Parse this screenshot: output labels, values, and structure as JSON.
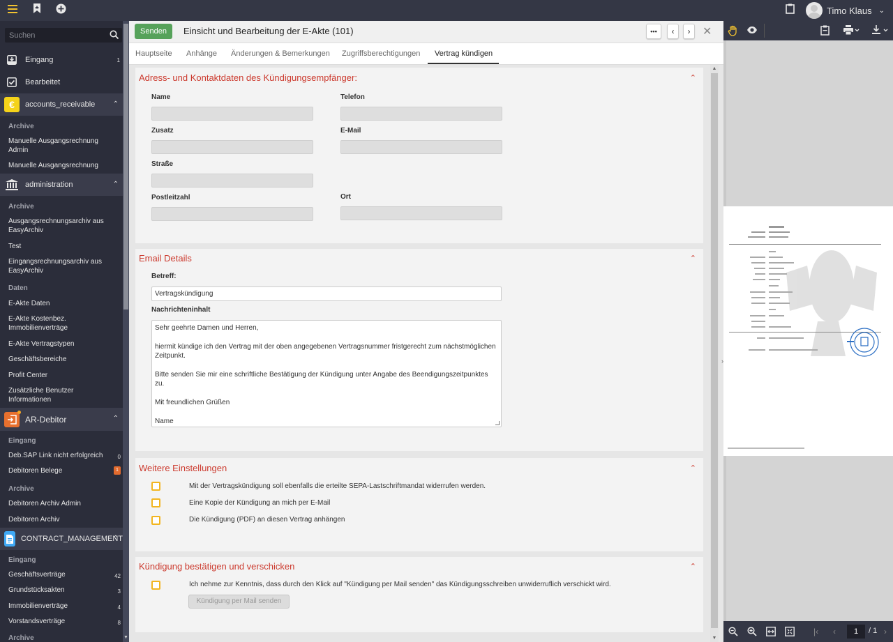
{
  "topbar": {
    "menu_icon": "hamburger-icon",
    "bookmark_icon": "bookmark-icon",
    "add_icon": "plus-circle-icon",
    "clipboard_icon": "clipboard-icon",
    "user_name": "Timo Klaus",
    "accent": "#f2c230"
  },
  "sidebar": {
    "search_placeholder": "Suchen",
    "main_items": [
      {
        "label": "Eingang",
        "count": "1"
      },
      {
        "label": "Bearbeitet"
      }
    ],
    "groups": [
      {
        "title": "accounts_receivable",
        "icon_glyph": "€",
        "icon_color": "#f5d31a",
        "sections": [
          {
            "title": "Archive",
            "items": [
              {
                "label": "Manuelle Ausgangsrechnung Admin"
              },
              {
                "label": "Manuelle Ausgangsrechnung"
              }
            ]
          }
        ]
      },
      {
        "title": "administration",
        "sections": [
          {
            "title": "Archive",
            "items": [
              {
                "label": "Ausgangsrechnungsarchiv aus EasyArchiv"
              },
              {
                "label": "Test"
              },
              {
                "label": "Eingangsrechnungsarchiv aus EasyArchiv"
              }
            ]
          },
          {
            "title": "Daten",
            "items": [
              {
                "label": "E-Akte Daten"
              },
              {
                "label": "E-Akte Kostenbez. Immobilienverträge"
              },
              {
                "label": "E-Akte Vertragstypen"
              },
              {
                "label": "Geschäftsbereiche"
              },
              {
                "label": "Profit Center"
              },
              {
                "label": "Zusätzliche Benutzer Informationen"
              }
            ]
          }
        ]
      },
      {
        "title": "AR-Debitor",
        "icon_color": "#e8702e",
        "sections": [
          {
            "title": "Eingang",
            "items": [
              {
                "label": "Deb.SAP Link nicht erfolgreich",
                "count": "0"
              },
              {
                "label": "Debitoren Belege",
                "count": "1"
              }
            ]
          },
          {
            "title": "Archive",
            "items": [
              {
                "label": "Debitoren Archiv Admin"
              },
              {
                "label": "Debitoren Archiv"
              }
            ]
          }
        ]
      },
      {
        "title": "CONTRACT_MANAGEMENT",
        "icon_color": "#3fa9f5",
        "sections": [
          {
            "title": "Eingang",
            "items": [
              {
                "label": "Geschäftsverträge",
                "count": "42"
              },
              {
                "label": "Grundstücksakten",
                "count": "3"
              },
              {
                "label": "Immobilienverträge",
                "count": "4"
              },
              {
                "label": "Vorstandsverträge",
                "count": "8"
              }
            ]
          },
          {
            "title": "Archive",
            "items": []
          }
        ]
      }
    ]
  },
  "header": {
    "send_label": "Senden",
    "title": "Einsicht und Bearbeitung der E-Akte (101)",
    "more_label": "•••",
    "prev_label": "‹",
    "next_label": "›",
    "close_label": "✕",
    "send_color": "#56a25a"
  },
  "tabs": [
    {
      "label": "Hauptseite"
    },
    {
      "label": "Anhänge"
    },
    {
      "label": "Änderungen & Bemerkungen"
    },
    {
      "label": "Zugriffsberechtigungen"
    },
    {
      "label": "Vertrag kündigen",
      "active": true
    }
  ],
  "address": {
    "title": "Adress- und Kontaktdaten des Kündigungsempfänger:",
    "fields": {
      "name": {
        "label": "Name",
        "value": ""
      },
      "telefon": {
        "label": "Telefon",
        "value": ""
      },
      "zusatz": {
        "label": "Zusatz",
        "value": ""
      },
      "email": {
        "label": "E-Mail",
        "value": ""
      },
      "strasse": {
        "label": "Straße",
        "value": ""
      },
      "plz": {
        "label": "Postleitzahl",
        "value": ""
      },
      "ort": {
        "label": "Ort",
        "value": ""
      }
    }
  },
  "email": {
    "title": "Email Details",
    "subject_label": "Betreff:",
    "subject_value": "Vertragskündigung",
    "body_label": "Nachrichteninhalt",
    "body_lines": [
      "Sehr geehrte Damen und Herren,",
      "hiermit kündige ich den Vertrag mit der oben angegebenen Vertragsnummer fristgerecht zum nächstmöglichen Zeitpunkt.",
      "Bitte senden Sie mir eine schriftliche Bestätigung der Kündigung unter Angabe des Beendigungszeitpunktes zu.",
      "Mit freundlichen Grüßen",
      "Name"
    ]
  },
  "settings": {
    "title": "Weitere Einstellungen",
    "options": [
      {
        "label": "Mit der Vertragskündigung soll ebenfalls die erteilte SEPA-Lastschriftmandat widerrufen werden.",
        "checked": false
      },
      {
        "label": "Eine Kopie der Kündigung an mich per E-Mail",
        "checked": false
      },
      {
        "label": "Die Kündigung (PDF) an diesen Vertrag anhängen",
        "checked": false
      }
    ]
  },
  "confirm": {
    "title": "Kündigung bestätigen und verschicken",
    "ack_label": "Ich nehme zur Kenntnis, dass durch den Klick auf \"Kündigung per Mail senden\" das Kündigungsschreiben unwiderruflich verschickt wird.",
    "ack_checked": false,
    "send_button": "Kündigung per Mail senden"
  },
  "viewer": {
    "current_page": "1",
    "total_pages": "/ 1",
    "tools": [
      "hand-icon",
      "eye-icon",
      "clipboard-icon",
      "print-icon",
      "download-icon"
    ]
  },
  "colors": {
    "section_title": "#cc3a2e",
    "checkbox_border": "#f2b51f"
  }
}
